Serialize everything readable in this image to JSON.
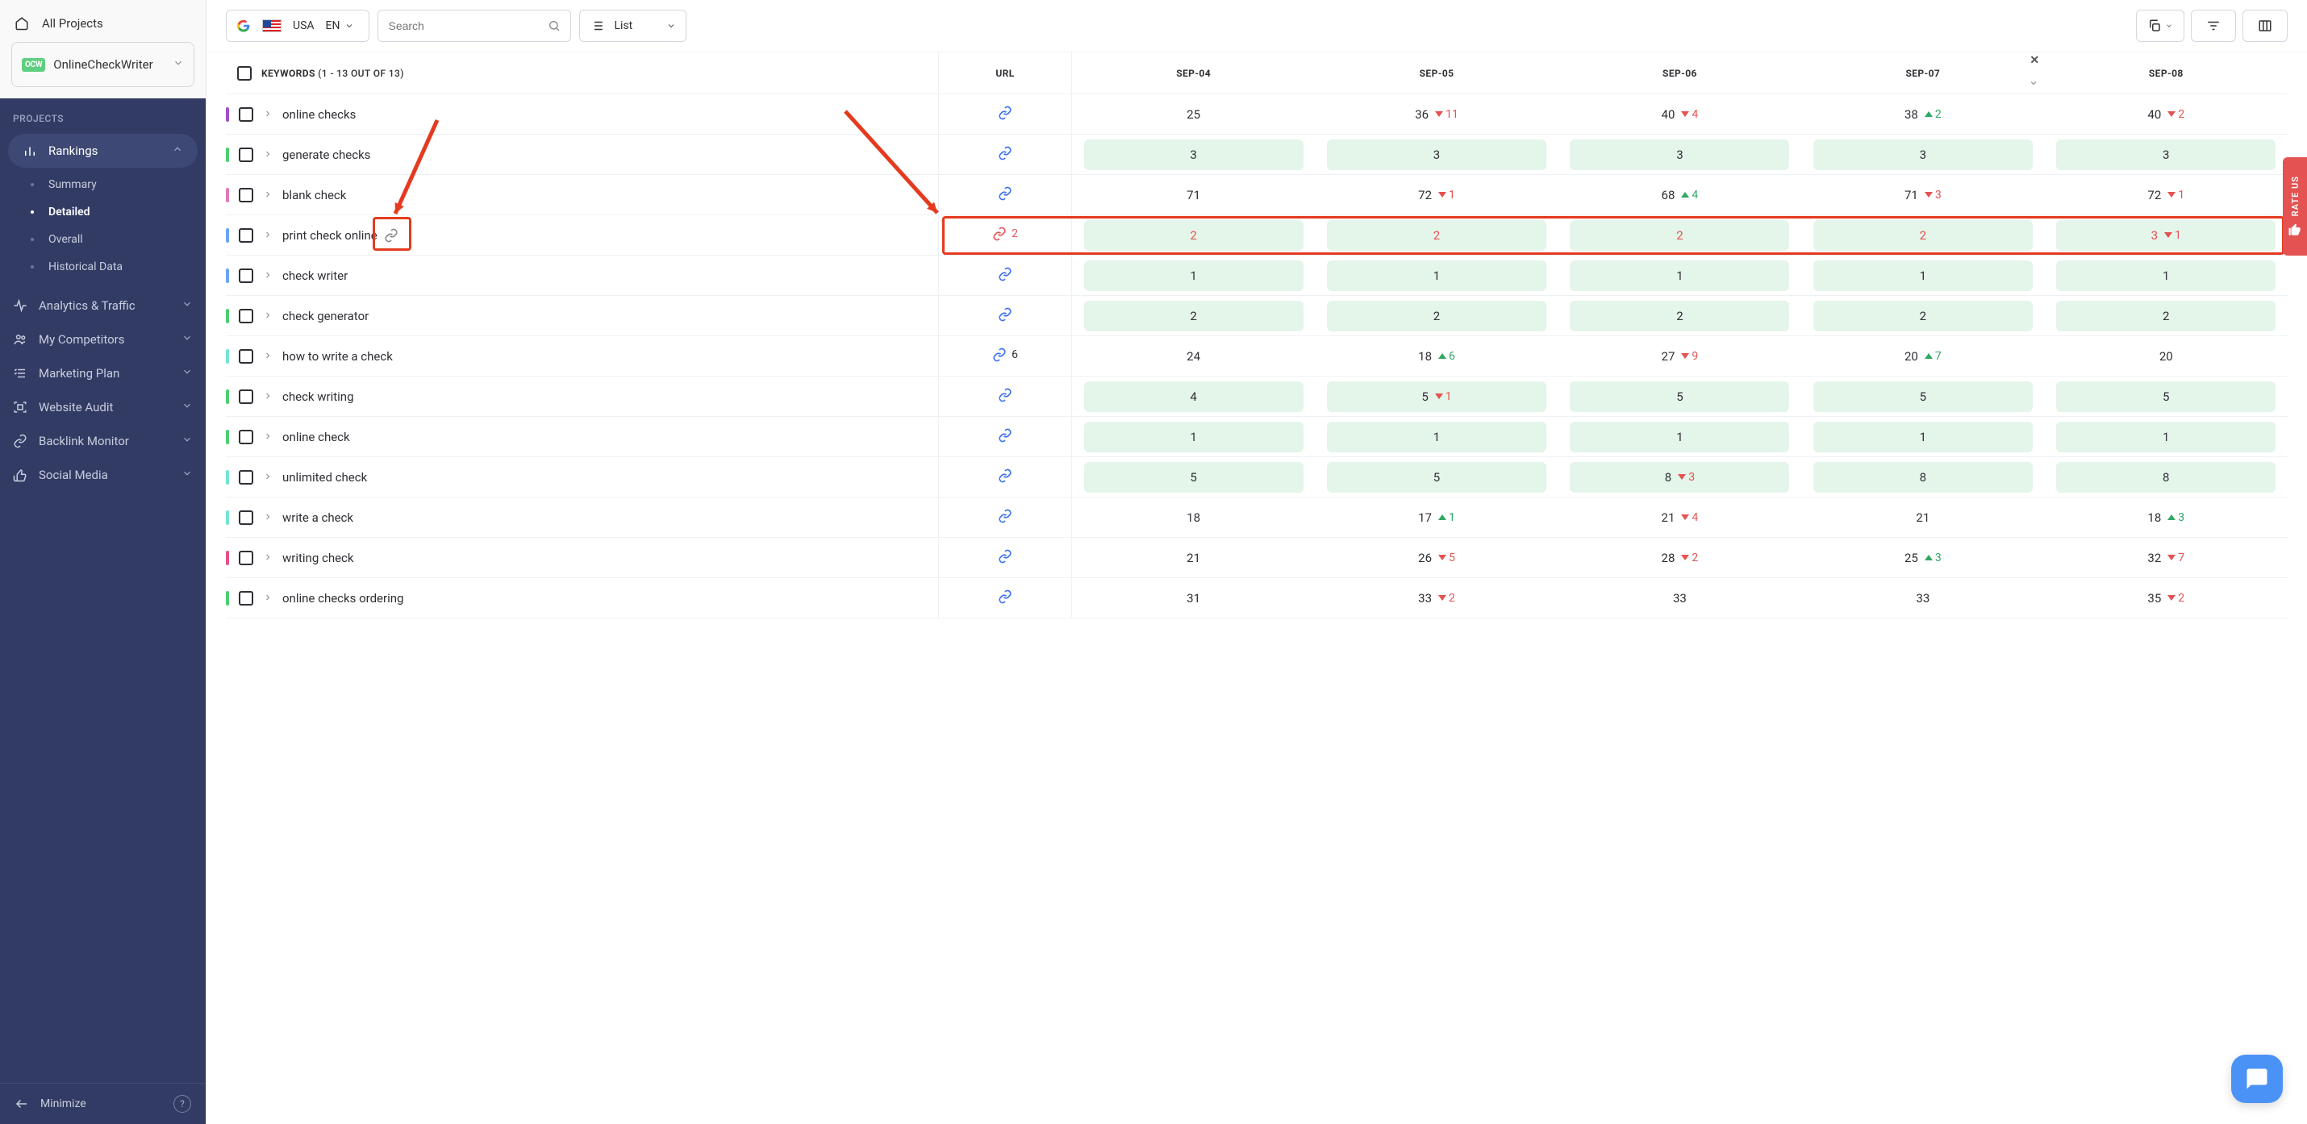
{
  "sidebar": {
    "all_projects": "All Projects",
    "project_badge": "OCW",
    "project_name": "OnlineCheckWriter",
    "projects_header": "PROJECTS",
    "nav": [
      {
        "label": "Rankings",
        "icon": "chart",
        "expanded": true,
        "sub": [
          {
            "label": "Summary"
          },
          {
            "label": "Detailed",
            "active": true
          },
          {
            "label": "Overall"
          },
          {
            "label": "Historical Data"
          }
        ]
      },
      {
        "label": "Analytics & Traffic",
        "icon": "pulse"
      },
      {
        "label": "My Competitors",
        "icon": "people"
      },
      {
        "label": "Marketing Plan",
        "icon": "list"
      },
      {
        "label": "Website Audit",
        "icon": "scan"
      },
      {
        "label": "Backlink Monitor",
        "icon": "link"
      },
      {
        "label": "Social Media",
        "icon": "thumb"
      }
    ],
    "minimize": "Minimize"
  },
  "toolbar": {
    "country": "USA",
    "lang": "EN",
    "search_placeholder": "Search",
    "view_label": "List"
  },
  "table": {
    "keywords_header": "KEYWORDS",
    "keywords_count": "(1 - 13 OUT OF 13)",
    "url_header": "URL",
    "date_headers": [
      "SEP-04",
      "SEP-05",
      "SEP-06",
      "SEP-07",
      "SEP-08"
    ],
    "rows": [
      {
        "stripe": "#a34fc5",
        "kw": "online checks",
        "url_count": null,
        "cells": [
          {
            "val": 25,
            "green": false
          },
          {
            "val": 36,
            "green": false,
            "delta": {
              "dir": "down",
              "n": 11
            }
          },
          {
            "val": 40,
            "green": false,
            "delta": {
              "dir": "down",
              "n": 4
            }
          },
          {
            "val": 38,
            "green": false,
            "delta": {
              "dir": "up",
              "n": 2
            }
          },
          {
            "val": 40,
            "green": false,
            "delta": {
              "dir": "down",
              "n": 2
            }
          }
        ]
      },
      {
        "stripe": "#4bcf6e",
        "kw": "generate checks",
        "url_count": null,
        "cells": [
          {
            "val": 3,
            "green": true
          },
          {
            "val": 3,
            "green": true
          },
          {
            "val": 3,
            "green": true
          },
          {
            "val": 3,
            "green": true
          },
          {
            "val": 3,
            "green": true
          }
        ]
      },
      {
        "stripe": "#e078b8",
        "kw": "blank check",
        "url_count": null,
        "cells": [
          {
            "val": 71,
            "green": false
          },
          {
            "val": 72,
            "green": false,
            "delta": {
              "dir": "down",
              "n": 1
            }
          },
          {
            "val": 68,
            "green": false,
            "delta": {
              "dir": "up",
              "n": 4
            }
          },
          {
            "val": 71,
            "green": false,
            "delta": {
              "dir": "down",
              "n": 3
            }
          },
          {
            "val": 72,
            "green": false,
            "delta": {
              "dir": "down",
              "n": 1
            }
          }
        ]
      },
      {
        "stripe": "#6aa3f7",
        "kw": "print check online",
        "highlight": true,
        "url_red": true,
        "url_count": 2,
        "cells": [
          {
            "val": 2,
            "green": true,
            "red": true
          },
          {
            "val": 2,
            "green": true,
            "red": true
          },
          {
            "val": 2,
            "green": true,
            "red": true
          },
          {
            "val": 2,
            "green": true,
            "red": true
          },
          {
            "val": 3,
            "green": true,
            "red": true,
            "delta": {
              "dir": "down",
              "n": 1
            }
          }
        ]
      },
      {
        "stripe": "#6aa3f7",
        "kw": "check writer",
        "url_count": null,
        "cells": [
          {
            "val": 1,
            "green": true
          },
          {
            "val": 1,
            "green": true
          },
          {
            "val": 1,
            "green": true
          },
          {
            "val": 1,
            "green": true
          },
          {
            "val": 1,
            "green": true
          }
        ]
      },
      {
        "stripe": "#4bcf6e",
        "kw": "check generator",
        "url_count": null,
        "cells": [
          {
            "val": 2,
            "green": true
          },
          {
            "val": 2,
            "green": true
          },
          {
            "val": 2,
            "green": true
          },
          {
            "val": 2,
            "green": true
          },
          {
            "val": 2,
            "green": true
          }
        ]
      },
      {
        "stripe": "#74e3d3",
        "kw": "how to write a check",
        "url_count": 6,
        "cells": [
          {
            "val": 24,
            "green": false
          },
          {
            "val": 18,
            "green": false,
            "delta": {
              "dir": "up",
              "n": 6
            }
          },
          {
            "val": 27,
            "green": false,
            "delta": {
              "dir": "down",
              "n": 9
            }
          },
          {
            "val": 20,
            "green": false,
            "delta": {
              "dir": "up",
              "n": 7
            }
          },
          {
            "val": 20,
            "green": false
          }
        ]
      },
      {
        "stripe": "#4bcf6e",
        "kw": "check writing",
        "url_count": null,
        "cells": [
          {
            "val": 4,
            "green": true
          },
          {
            "val": 5,
            "green": true,
            "delta": {
              "dir": "down",
              "n": 1
            }
          },
          {
            "val": 5,
            "green": true
          },
          {
            "val": 5,
            "green": true
          },
          {
            "val": 5,
            "green": true
          }
        ]
      },
      {
        "stripe": "#4bcf6e",
        "kw": "online check",
        "url_count": null,
        "cells": [
          {
            "val": 1,
            "green": true
          },
          {
            "val": 1,
            "green": true
          },
          {
            "val": 1,
            "green": true
          },
          {
            "val": 1,
            "green": true
          },
          {
            "val": 1,
            "green": true
          }
        ]
      },
      {
        "stripe": "#74e3d3",
        "kw": "unlimited check",
        "url_count": null,
        "cells": [
          {
            "val": 5,
            "green": true
          },
          {
            "val": 5,
            "green": true
          },
          {
            "val": 8,
            "green": true,
            "delta": {
              "dir": "down",
              "n": 3
            }
          },
          {
            "val": 8,
            "green": true
          },
          {
            "val": 8,
            "green": true
          }
        ]
      },
      {
        "stripe": "#74e3d3",
        "kw": "write a check",
        "url_count": null,
        "cells": [
          {
            "val": 18,
            "green": false
          },
          {
            "val": 17,
            "green": false,
            "delta": {
              "dir": "up",
              "n": 1
            }
          },
          {
            "val": 21,
            "green": false,
            "delta": {
              "dir": "down",
              "n": 4
            }
          },
          {
            "val": 21,
            "green": false
          },
          {
            "val": 18,
            "green": false,
            "delta": {
              "dir": "up",
              "n": 3
            }
          }
        ]
      },
      {
        "stripe": "#e2508a",
        "kw": "writing check",
        "url_count": null,
        "cells": [
          {
            "val": 21,
            "green": false
          },
          {
            "val": 26,
            "green": false,
            "delta": {
              "dir": "down",
              "n": 5
            }
          },
          {
            "val": 28,
            "green": false,
            "delta": {
              "dir": "down",
              "n": 2
            }
          },
          {
            "val": 25,
            "green": false,
            "delta": {
              "dir": "up",
              "n": 3
            }
          },
          {
            "val": 32,
            "green": false,
            "delta": {
              "dir": "down",
              "n": 7
            }
          }
        ]
      },
      {
        "stripe": "#4bcf6e",
        "kw": "online checks ordering",
        "url_count": null,
        "cells": [
          {
            "val": 31,
            "green": false
          },
          {
            "val": 33,
            "green": false,
            "delta": {
              "dir": "down",
              "n": 2
            }
          },
          {
            "val": 33,
            "green": false
          },
          {
            "val": 33,
            "green": false
          },
          {
            "val": 35,
            "green": false,
            "delta": {
              "dir": "down",
              "n": 2
            }
          }
        ]
      }
    ]
  },
  "rate_us": "RATE US"
}
